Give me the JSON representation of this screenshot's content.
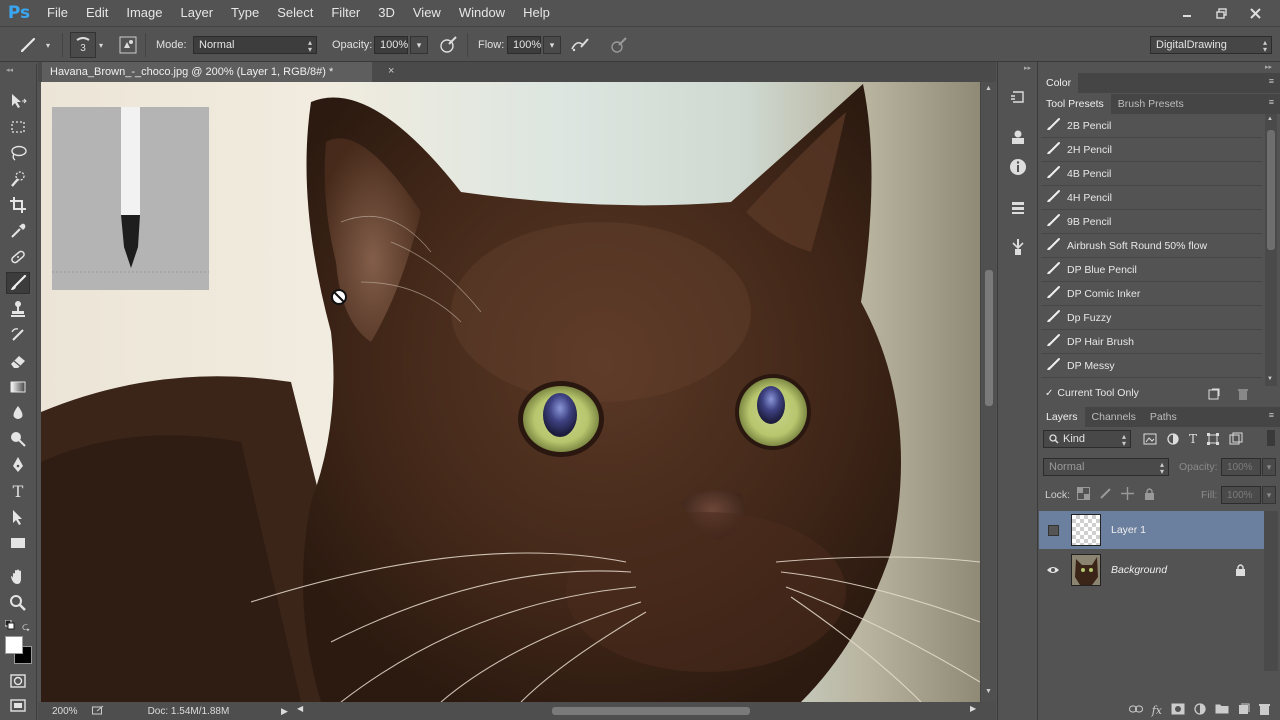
{
  "app": {
    "logo": "Ps",
    "menu": [
      "File",
      "Edit",
      "Image",
      "Layer",
      "Type",
      "Select",
      "Filter",
      "3D",
      "View",
      "Window",
      "Help"
    ]
  },
  "options": {
    "brush_size": "3",
    "mode_label": "Mode:",
    "mode_value": "Normal",
    "opacity_label": "Opacity:",
    "opacity_value": "100%",
    "flow_label": "Flow:",
    "flow_value": "100%",
    "workspace": "DigitalDrawing"
  },
  "document": {
    "tab_title": "Havana_Brown_-_choco.jpg @ 200% (Layer 1, RGB/8#) *",
    "close": "×"
  },
  "status": {
    "zoom": "200%",
    "doc_info": "Doc: 1.54M/1.88M"
  },
  "panels": {
    "color_tab": "Color",
    "preset_tabs": [
      "Tool Presets",
      "Brush Presets"
    ],
    "presets": [
      "2B Pencil",
      "2H Pencil",
      "4B Pencil",
      "4H Pencil",
      "9B Pencil",
      "Airbrush Soft Round 50% flow",
      "DP Blue Pencil",
      "DP Comic Inker",
      "Dp Fuzzy",
      "DP Hair Brush",
      "DP Messy"
    ],
    "current_tool_only": "Current Tool Only",
    "layer_tabs": [
      "Layers",
      "Channels",
      "Paths"
    ],
    "kind_filter": "Kind",
    "blend_mode": "Normal",
    "opacity_label": "Opacity:",
    "opacity_value": "100%",
    "lock_label": "Lock:",
    "fill_label": "Fill:",
    "fill_value": "100%",
    "layers": [
      {
        "name": "Layer 1",
        "visible": false,
        "selected": true
      },
      {
        "name": "Background",
        "visible": true,
        "selected": false,
        "locked": true
      }
    ]
  },
  "colors": {
    "ui_bg": "#535353",
    "selected_layer": "#6b7f9e",
    "ps_blue": "#3aa6f2"
  }
}
